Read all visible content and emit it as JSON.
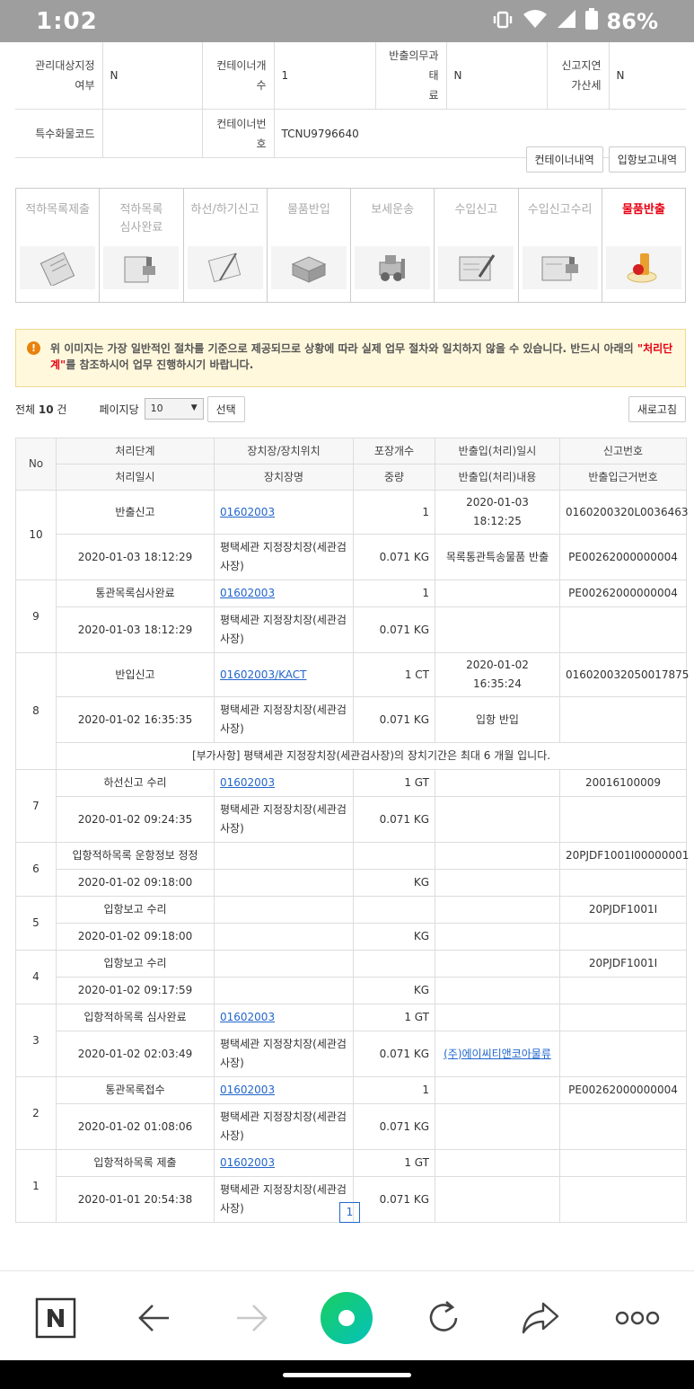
{
  "status_bar": {
    "time": "1:02",
    "battery": "86%"
  },
  "info_rows": [
    [
      {
        "label": "관리대상지정\n여부",
        "value": "N"
      },
      {
        "label": "컨테이너개\n수",
        "value": "1"
      },
      {
        "label": "반출의무과태\n료",
        "value": "N"
      },
      {
        "label": "신고지연\n가산세",
        "value": "N"
      }
    ],
    [
      {
        "label": "특수화물코드",
        "value": ""
      },
      {
        "label": "컨테이너번\n호",
        "value": "TCNU9796640"
      }
    ]
  ],
  "buttons": {
    "container_history": "컨테이너내역",
    "entry_report_history": "입항보고내역"
  },
  "steps": [
    {
      "label": "적하목록제출",
      "icon": "clipboard-icon",
      "active": false
    },
    {
      "label": "적하목록\n심사완료",
      "icon": "stamp-icon",
      "active": false
    },
    {
      "label": "하선/하기신고",
      "icon": "notebook-pen-icon",
      "active": false
    },
    {
      "label": "물품반입",
      "icon": "boxes-icon",
      "active": false
    },
    {
      "label": "보세운송",
      "icon": "forklift-icon",
      "active": false
    },
    {
      "label": "수입신고",
      "icon": "document-pen-icon",
      "active": false
    },
    {
      "label": "수입신고수리",
      "icon": "document-stamp-icon",
      "active": false
    },
    {
      "label": "물품반출",
      "icon": "seal-icon",
      "active": true
    }
  ],
  "notice": {
    "text_before": "위 이미지는 가장 일반적인 절차를 기준으로 제공되므로 상황에 따라 실제 업무 절차와 일치하지 않을 수 있습니다. 반드시 아래의 ",
    "highlight": "\"처리단계\"",
    "text_after": "를 참조하시어 업무 진행하시기 바랍니다."
  },
  "list_controls": {
    "total_prefix": "전체 ",
    "total_count": "10",
    "total_suffix": " 건",
    "per_page_label": "페이지당",
    "per_page_value": "10",
    "select_button": "선택",
    "refresh_button": "새로고침"
  },
  "table_headers": {
    "no": "No",
    "row1": [
      "처리단계",
      "장치장/장치위치",
      "포장개수",
      "반출입(처리)일시",
      "신고번호"
    ],
    "row2": [
      "처리일시",
      "장치장명",
      "중량",
      "반출입(처리)내용",
      "반출입근거번호"
    ]
  },
  "history": [
    {
      "no": "10",
      "stage": "반출신고",
      "location": "01602003",
      "packages": "1",
      "io_datetime": "2020-01-03 18:12:25",
      "report_no": "0160200320L0036463",
      "proc_datetime": "2020-01-03 18:12:29",
      "warehouse": "평택세관 지정장치장(세관검사장)",
      "weight": "0.071 KG",
      "io_content": "목록통관특송물품 반출",
      "basis_no": "PE00262000000004"
    },
    {
      "no": "9",
      "stage": "통관목록심사완료",
      "location": "01602003",
      "packages": "1",
      "io_datetime": "",
      "report_no": "PE00262000000004",
      "proc_datetime": "2020-01-03 18:12:29",
      "warehouse": "평택세관 지정장치장(세관검사장)",
      "weight": "0.071 KG",
      "io_content": "",
      "basis_no": ""
    },
    {
      "no": "8",
      "stage": "반입신고",
      "location": "01602003/KACT",
      "packages": "1 CT",
      "io_datetime": "2020-01-02 16:35:24",
      "report_no": "016020032050017875",
      "proc_datetime": "2020-01-02 16:35:35",
      "warehouse": "평택세관 지정장치장(세관검사장)",
      "weight": "0.071 KG",
      "io_content": "입항 반입",
      "basis_no": "",
      "note": "[부가사항] 평택세관 지정장치장(세관검사장)의 장치기간은 최대 6 개월 입니다."
    },
    {
      "no": "7",
      "stage": "하선신고 수리",
      "location": "01602003",
      "packages": "1 GT",
      "io_datetime": "",
      "report_no": "20016100009",
      "proc_datetime": "2020-01-02 09:24:35",
      "warehouse": "평택세관 지정장치장(세관검사장)",
      "weight": "0.071 KG",
      "io_content": "",
      "basis_no": ""
    },
    {
      "no": "6",
      "stage": "입항적하목록 운항정보 정정",
      "location": "",
      "packages": "",
      "io_datetime": "",
      "report_no": "20PJDF1001I00000001",
      "proc_datetime": "2020-01-02 09:18:00",
      "warehouse": "",
      "weight": "KG",
      "io_content": "",
      "basis_no": ""
    },
    {
      "no": "5",
      "stage": "입항보고 수리",
      "location": "",
      "packages": "",
      "io_datetime": "",
      "report_no": "20PJDF1001I",
      "proc_datetime": "2020-01-02 09:18:00",
      "warehouse": "",
      "weight": "KG",
      "io_content": "",
      "basis_no": ""
    },
    {
      "no": "4",
      "stage": "입항보고 수리",
      "location": "",
      "packages": "",
      "io_datetime": "",
      "report_no": "20PJDF1001I",
      "proc_datetime": "2020-01-02 09:17:59",
      "warehouse": "",
      "weight": "KG",
      "io_content": "",
      "basis_no": ""
    },
    {
      "no": "3",
      "stage": "입항적하목록 심사완료",
      "location": "01602003",
      "packages": "1 GT",
      "io_datetime": "",
      "report_no": "",
      "proc_datetime": "2020-01-02 02:03:49",
      "warehouse": "평택세관 지정장치장(세관검사장)",
      "weight": "0.071 KG",
      "io_content": "(주)에이씨티앤코아물류",
      "basis_no": ""
    },
    {
      "no": "2",
      "stage": "통관목록접수",
      "location": "01602003",
      "packages": "1",
      "io_datetime": "",
      "report_no": "PE00262000000004",
      "proc_datetime": "2020-01-02 01:08:06",
      "warehouse": "평택세관 지정장치장(세관검사장)",
      "weight": "0.071 KG",
      "io_content": "",
      "basis_no": ""
    },
    {
      "no": "1",
      "stage": "입항적하목록 제출",
      "location": "01602003",
      "packages": "1 GT",
      "io_datetime": "",
      "report_no": "",
      "proc_datetime": "2020-01-01 20:54:38",
      "warehouse": "평택세관 지정장치장(세관검사장)",
      "weight": "0.071 KG",
      "io_content": "",
      "basis_no": ""
    }
  ],
  "pagination": {
    "current": "1"
  },
  "browser_nav": [
    "naver-home-icon",
    "back-arrow-icon",
    "forward-arrow-icon",
    "green-dot-icon",
    "reload-icon",
    "share-icon",
    "more-icon"
  ]
}
